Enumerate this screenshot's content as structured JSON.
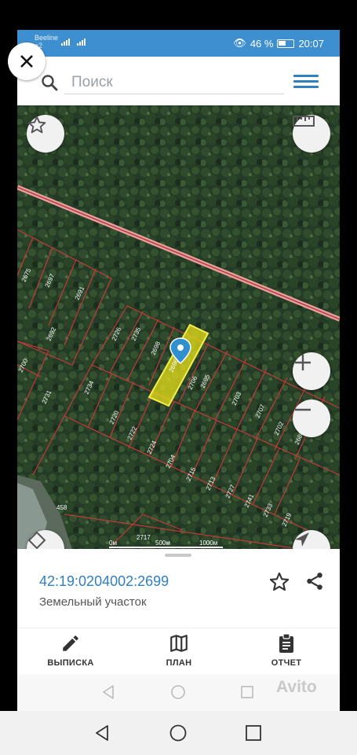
{
  "status_bar": {
    "carrier_line1": "Beeline",
    "carrier_line2": "e2",
    "battery": "46 %",
    "time": "20:07"
  },
  "search": {
    "placeholder": "Поиск"
  },
  "map": {
    "plot_labels": [
      "2675",
      "2697",
      "2691",
      "2692",
      "2700",
      "2726",
      "2735",
      "2698",
      "2696",
      "2706",
      "2695",
      "2703",
      "2707",
      "2702",
      "2680",
      "2734",
      "2720",
      "2722",
      "2724",
      "2704",
      "2715",
      "2713",
      "2727",
      "2741",
      "2733",
      "2719",
      "2731",
      "2717",
      "458"
    ],
    "scale_labels": [
      "0м",
      "500м",
      "1000м"
    ],
    "highlight_color": "#e8e21a",
    "boundary_color": "#c23a3a"
  },
  "info_card": {
    "cadastral_number": "42:19:0204002:2699",
    "object_type": "Земельный участок"
  },
  "tabs": [
    {
      "label": "ВЫПИСКА",
      "icon": "pencil-icon"
    },
    {
      "label": "ПЛАН",
      "icon": "map-icon"
    },
    {
      "label": "ОТЧЕТ",
      "icon": "clipboard-icon"
    }
  ],
  "watermark": "Avito",
  "colors": {
    "accent": "#3e8fd0",
    "link": "#2f7fc1"
  }
}
